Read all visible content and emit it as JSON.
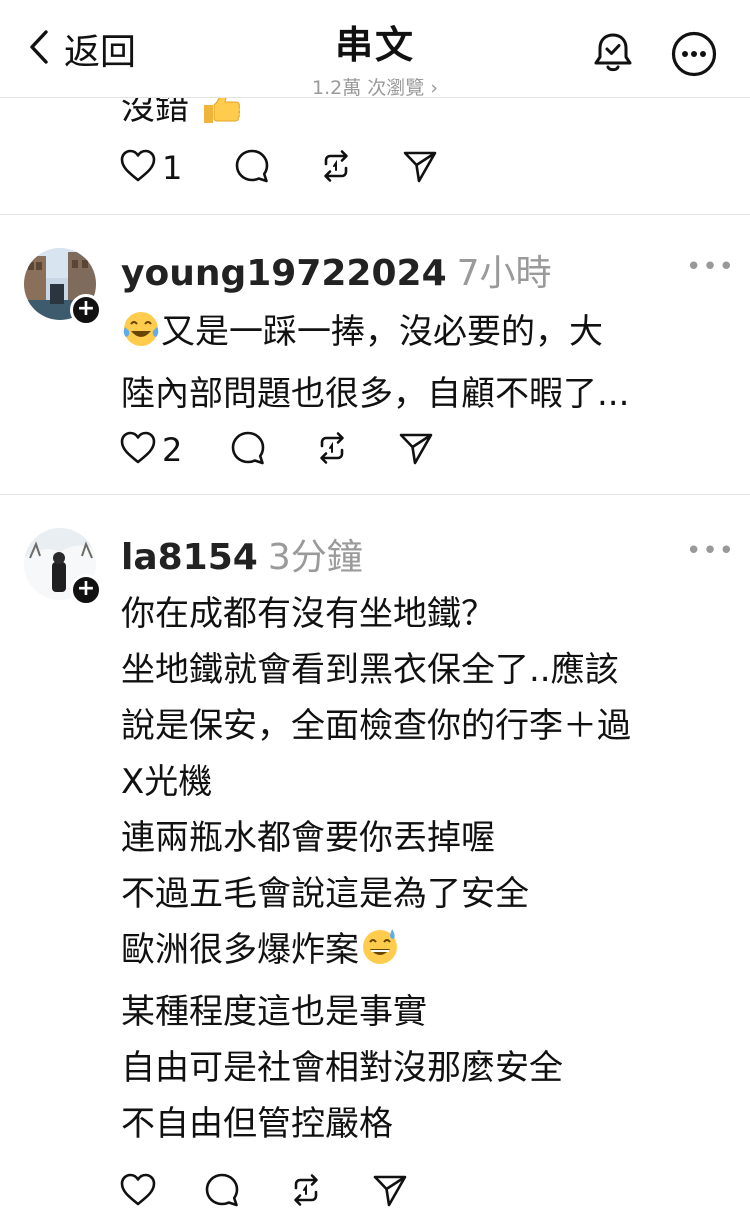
{
  "header": {
    "back_label": "返回",
    "title": "串文",
    "views": "1.2萬 次瀏覽 ›"
  },
  "posts": [
    {
      "lines": [
        "沒錯"
      ],
      "likes": "1"
    },
    {
      "username": "young19722024",
      "time": "7小時",
      "lines": [
        "又是一踩一捧，沒必要的，大",
        "陸內部問題也很多，自顧不暇了..."
      ],
      "likes": "2"
    },
    {
      "username": "la8154",
      "time": "3分鐘",
      "lines": [
        "你在成都有沒有坐地鐵？",
        "坐地鐵就會看到黑衣保全了..應該",
        "說是保安，全面檢查你的行李＋過",
        "X光機",
        "連兩瓶水都會要你丟掉喔",
        "不過五毛會說這是為了安全",
        "歐洲很多爆炸案",
        "某種程度這也是事實",
        "自由可是社會相對沒那麼安全",
        "不自由但管控嚴格"
      ],
      "likes": ""
    }
  ],
  "icons": {
    "back": "chevron-left-icon",
    "notify": "bell-check-icon",
    "menu": "more-horizontal-circle-icon",
    "like": "heart-icon",
    "reply": "comment-icon",
    "repost": "repost-icon",
    "share": "send-icon",
    "emoji_thumbs": "thumbs-up-emoji",
    "emoji_laugh": "tears-of-joy-emoji",
    "emoji_sweat": "grinning-sweat-emoji"
  }
}
